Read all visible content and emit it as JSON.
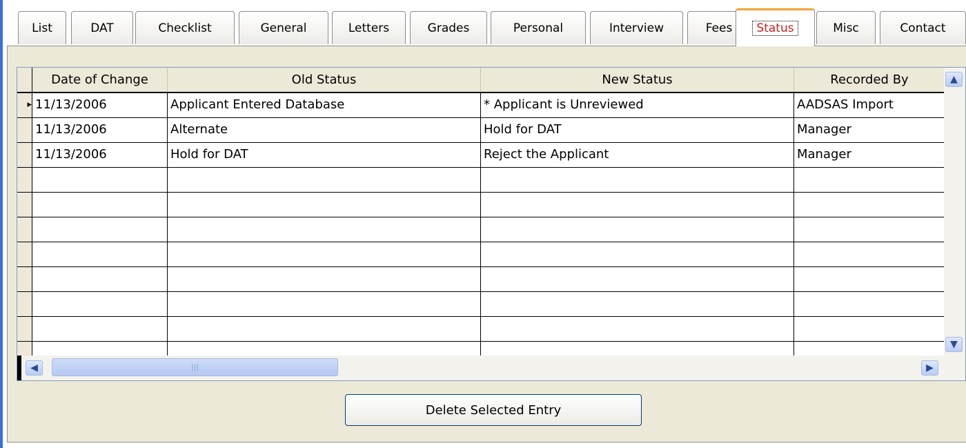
{
  "tabs": [
    {
      "label": "List"
    },
    {
      "label": "DAT"
    },
    {
      "label": "Checklist"
    },
    {
      "label": "General"
    },
    {
      "label": "Letters"
    },
    {
      "label": "Grades"
    },
    {
      "label": "Personal"
    },
    {
      "label": "Interview"
    },
    {
      "label": "Fees"
    },
    {
      "label": "Status",
      "active": true
    },
    {
      "label": "Misc"
    },
    {
      "label": "Contact"
    }
  ],
  "grid": {
    "headers": [
      "Date of Change",
      "Old Status",
      "New Status",
      "Recorded By"
    ],
    "rows": [
      [
        "11/13/2006",
        "Applicant Entered Database",
        "* Applicant is Unreviewed",
        "AADSAS Import"
      ],
      [
        "11/13/2006",
        "Alternate",
        "Hold for DAT",
        "Manager"
      ],
      [
        "11/13/2006",
        "Hold for DAT",
        "Reject the Applicant",
        "Manager"
      ]
    ],
    "empty_rows": 8
  },
  "actions": {
    "delete_label": "Delete Selected Entry"
  }
}
